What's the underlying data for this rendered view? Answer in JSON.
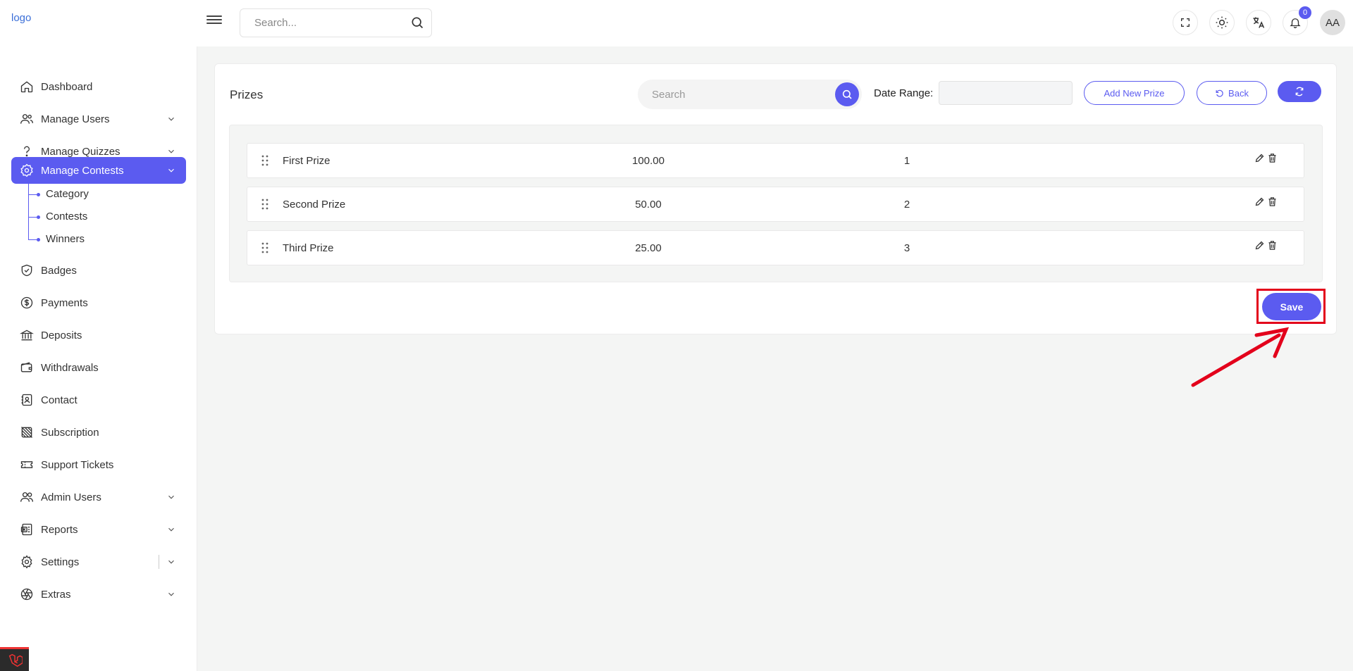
{
  "header": {
    "logo_alt": "logo",
    "search_placeholder": "Search...",
    "notification_count": "0",
    "avatar_initials": "AA"
  },
  "sidebar": {
    "items": [
      {
        "label": "Dashboard",
        "icon": "home-icon"
      },
      {
        "label": "Manage Users",
        "icon": "users-icon"
      },
      {
        "label": "Manage Quizzes",
        "icon": "question-icon"
      },
      {
        "label": "Manage Contests",
        "icon": "gear-badge-icon"
      },
      {
        "label": "Badges",
        "icon": "shield-check-icon"
      },
      {
        "label": "Payments",
        "icon": "dollar-circle-icon"
      },
      {
        "label": "Deposits",
        "icon": "bank-icon"
      },
      {
        "label": "Withdrawals",
        "icon": "wallet-icon"
      },
      {
        "label": "Contact",
        "icon": "contact-book-icon"
      },
      {
        "label": "Subscription",
        "icon": "subscription-icon"
      },
      {
        "label": "Support Tickets",
        "icon": "ticket-icon"
      },
      {
        "label": "Admin Users",
        "icon": "admin-users-icon"
      },
      {
        "label": "Reports",
        "icon": "report-icon"
      },
      {
        "label": "Settings",
        "icon": "gear-icon"
      },
      {
        "label": "Extras",
        "icon": "aperture-icon"
      }
    ],
    "contest_subitems": [
      "Category",
      "Contests",
      "Winners"
    ]
  },
  "main": {
    "title": "Prizes",
    "search_placeholder": "Search",
    "date_range_label": "Date Range:",
    "add_button_label": "Add New Prize",
    "back_button_label": "Back",
    "prizes": [
      {
        "name": "First Prize",
        "amount": "100.00",
        "rank": "1"
      },
      {
        "name": "Second Prize",
        "amount": "50.00",
        "rank": "2"
      },
      {
        "name": "Third Prize",
        "amount": "25.00",
        "rank": "3"
      }
    ],
    "save_label": "Save"
  },
  "colors": {
    "accent": "#5b5bf0",
    "annotation_red": "#e3001b",
    "background": "#f4f5f4"
  }
}
